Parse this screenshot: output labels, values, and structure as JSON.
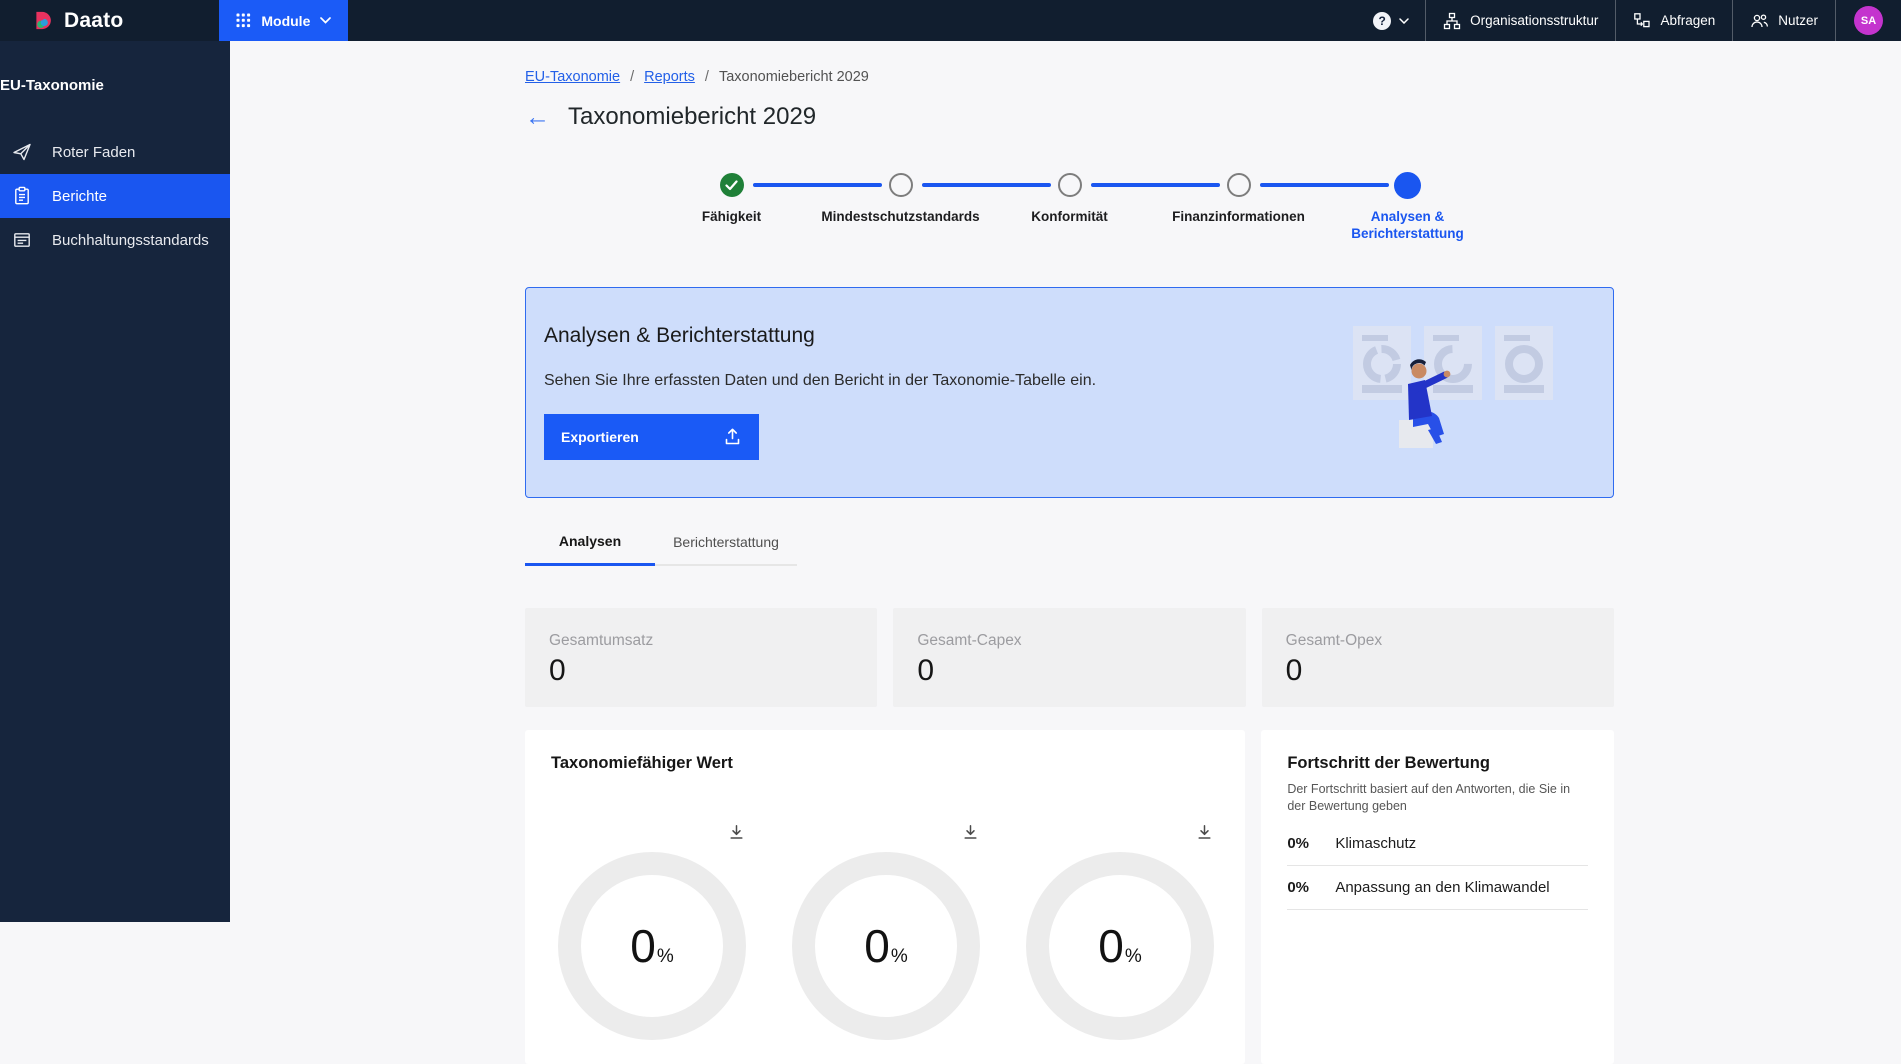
{
  "colors": {
    "accent_blue": "#1A56F0",
    "module_button_blue": "#1B5BF7",
    "topbar_bg": "#111E2F",
    "sidebar_bg": "#16253D",
    "banner_bg": "#CEDDFB",
    "banner_border": "#2F6BF0",
    "complete_green": "#1F8038",
    "avatar_purple": "#C434CE"
  },
  "topbar": {
    "logo_text": "Daato",
    "module_button": "Module",
    "help_glyph": "?",
    "nav": [
      {
        "label": "Organisationsstruktur",
        "icon": "org-structure-icon"
      },
      {
        "label": "Abfragen",
        "icon": "workflow-icon"
      },
      {
        "label": "Nutzer",
        "icon": "users-icon"
      }
    ],
    "avatar_initials": "SA"
  },
  "sidebar": {
    "section_title": "EU-Taxonomie",
    "items": [
      {
        "label": "Roter Faden",
        "icon": "paper-plane-icon",
        "active": false
      },
      {
        "label": "Berichte",
        "icon": "clipboard-icon",
        "active": true
      },
      {
        "label": "Buchhaltungsstandards",
        "icon": "ledger-icon",
        "active": false
      }
    ]
  },
  "breadcrumb": {
    "separator": "/",
    "items": [
      {
        "label": "EU-Taxonomie",
        "link": true
      },
      {
        "label": "Reports",
        "link": true
      },
      {
        "label": "Taxonomiebericht 2029",
        "link": false
      }
    ]
  },
  "page": {
    "back_glyph": "←",
    "title": "Taxonomiebericht 2029"
  },
  "stepper": {
    "steps": [
      {
        "label": "Fähigkeit",
        "state": "complete"
      },
      {
        "label": "Mindestschutzstandards",
        "state": "upcoming"
      },
      {
        "label": "Konformität",
        "state": "upcoming"
      },
      {
        "label": "Finanzinformationen",
        "state": "upcoming"
      },
      {
        "label": "Analysen & Berichterstattung",
        "state": "current"
      }
    ]
  },
  "banner": {
    "title": "Analysen & Berichterstattung",
    "description": "Sehen Sie Ihre erfassten Daten und den Bericht in der Taxonomie-Tabelle ein.",
    "export_button": "Exportieren"
  },
  "tabs": [
    {
      "label": "Analysen",
      "active": true
    },
    {
      "label": "Berichterstattung",
      "active": false
    }
  ],
  "stats": [
    {
      "label": "Gesamtumsatz",
      "value": "0"
    },
    {
      "label": "Gesamt-Capex",
      "value": "0"
    },
    {
      "label": "Gesamt-Opex",
      "value": "0"
    }
  ],
  "chart_card": {
    "title": "Taxonomiefähiger Wert",
    "donuts": [
      {
        "value": "0",
        "unit": "%"
      },
      {
        "value": "0",
        "unit": "%"
      },
      {
        "value": "0",
        "unit": "%"
      }
    ]
  },
  "progress_card": {
    "title": "Fortschritt der Bewertung",
    "subtitle": "Der Fortschritt basiert auf den Antworten, die Sie in der Bewertung geben",
    "rows": [
      {
        "percent": "0%",
        "label": "Klimaschutz"
      },
      {
        "percent": "0%",
        "label": "Anpassung an den Klimawandel"
      }
    ]
  }
}
